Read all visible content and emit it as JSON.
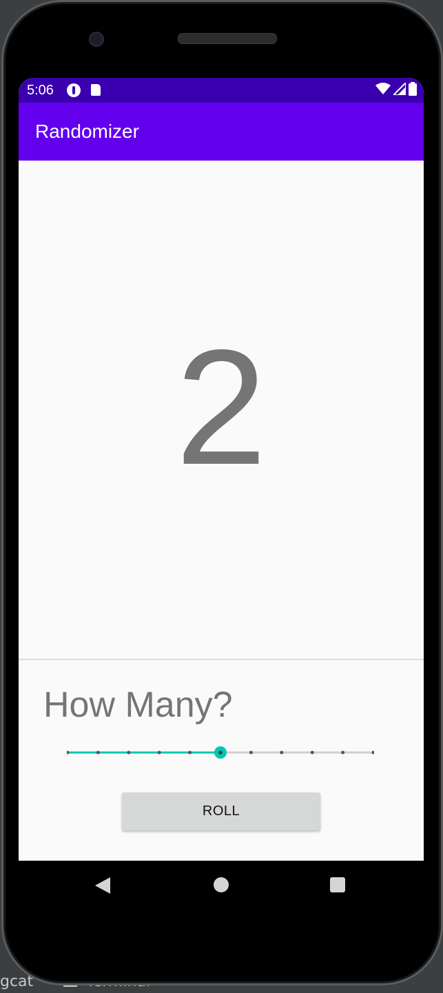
{
  "status_bar": {
    "time": "5:06",
    "icons": [
      "pocket-casts-icon",
      "sd-card-icon",
      "wifi-icon",
      "cell-signal-icon",
      "battery-icon"
    ]
  },
  "app_bar": {
    "title": "Randomizer"
  },
  "result": {
    "value": "2"
  },
  "controls": {
    "prompt": "How Many?",
    "slider": {
      "value": 6,
      "ticks": 11,
      "active_color": "#00c8b4"
    },
    "roll_label": "ROLL"
  },
  "colors": {
    "status_bar": "#3a00b0",
    "app_bar": "#6200ee",
    "background": "#fafafa",
    "text_secondary": "#757575"
  },
  "ide": {
    "bottom_left_text": "gcat",
    "bottom_tab_text": "Terminal"
  }
}
